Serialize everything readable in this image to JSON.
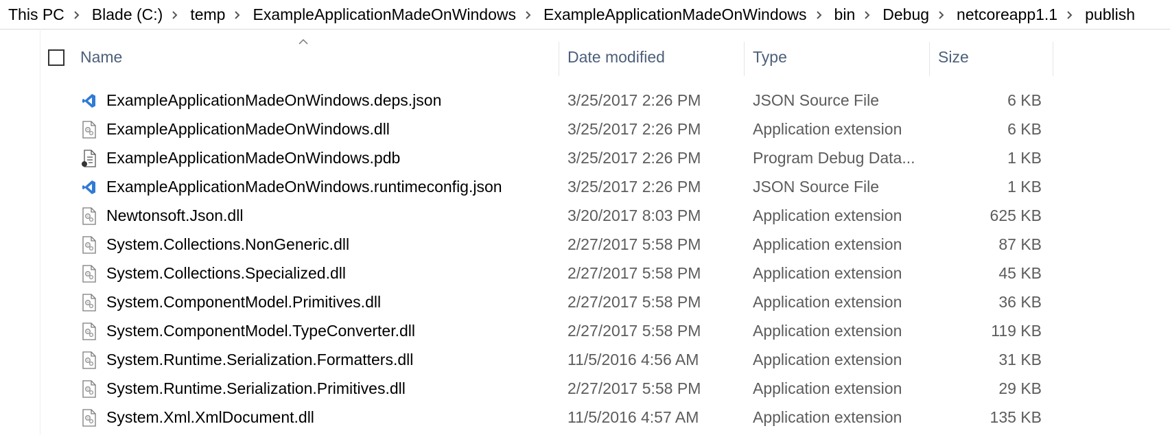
{
  "breadcrumb": [
    "This PC",
    "Blade (C:)",
    "temp",
    "ExampleApplicationMadeOnWindows",
    "ExampleApplicationMadeOnWindows",
    "bin",
    "Debug",
    "netcoreapp1.1",
    "publish"
  ],
  "columns": {
    "name": "Name",
    "date": "Date modified",
    "type": "Type",
    "size": "Size"
  },
  "files": [
    {
      "name": "ExampleApplicationMadeOnWindows.deps.json",
      "date": "3/25/2017 2:26 PM",
      "type": "JSON Source File",
      "size": "6 KB",
      "icon": "vscode-json-icon"
    },
    {
      "name": "ExampleApplicationMadeOnWindows.dll",
      "date": "3/25/2017 2:26 PM",
      "type": "Application extension",
      "size": "6 KB",
      "icon": "dll-file-icon"
    },
    {
      "name": "ExampleApplicationMadeOnWindows.pdb",
      "date": "3/25/2017 2:26 PM",
      "type": "Program Debug Data...",
      "size": "1 KB",
      "icon": "pdb-file-icon"
    },
    {
      "name": "ExampleApplicationMadeOnWindows.runtimeconfig.json",
      "date": "3/25/2017 2:26 PM",
      "type": "JSON Source File",
      "size": "1 KB",
      "icon": "vscode-json-icon"
    },
    {
      "name": "Newtonsoft.Json.dll",
      "date": "3/20/2017 8:03 PM",
      "type": "Application extension",
      "size": "625 KB",
      "icon": "dll-file-icon"
    },
    {
      "name": "System.Collections.NonGeneric.dll",
      "date": "2/27/2017 5:58 PM",
      "type": "Application extension",
      "size": "87 KB",
      "icon": "dll-file-icon"
    },
    {
      "name": "System.Collections.Specialized.dll",
      "date": "2/27/2017 5:58 PM",
      "type": "Application extension",
      "size": "45 KB",
      "icon": "dll-file-icon"
    },
    {
      "name": "System.ComponentModel.Primitives.dll",
      "date": "2/27/2017 5:58 PM",
      "type": "Application extension",
      "size": "36 KB",
      "icon": "dll-file-icon"
    },
    {
      "name": "System.ComponentModel.TypeConverter.dll",
      "date": "2/27/2017 5:58 PM",
      "type": "Application extension",
      "size": "119 KB",
      "icon": "dll-file-icon"
    },
    {
      "name": "System.Runtime.Serialization.Formatters.dll",
      "date": "11/5/2016 4:56 AM",
      "type": "Application extension",
      "size": "31 KB",
      "icon": "dll-file-icon"
    },
    {
      "name": "System.Runtime.Serialization.Primitives.dll",
      "date": "2/27/2017 5:58 PM",
      "type": "Application extension",
      "size": "29 KB",
      "icon": "dll-file-icon"
    },
    {
      "name": "System.Xml.XmlDocument.dll",
      "date": "11/5/2016 4:57 AM",
      "type": "Application extension",
      "size": "135 KB",
      "icon": "dll-file-icon"
    }
  ]
}
